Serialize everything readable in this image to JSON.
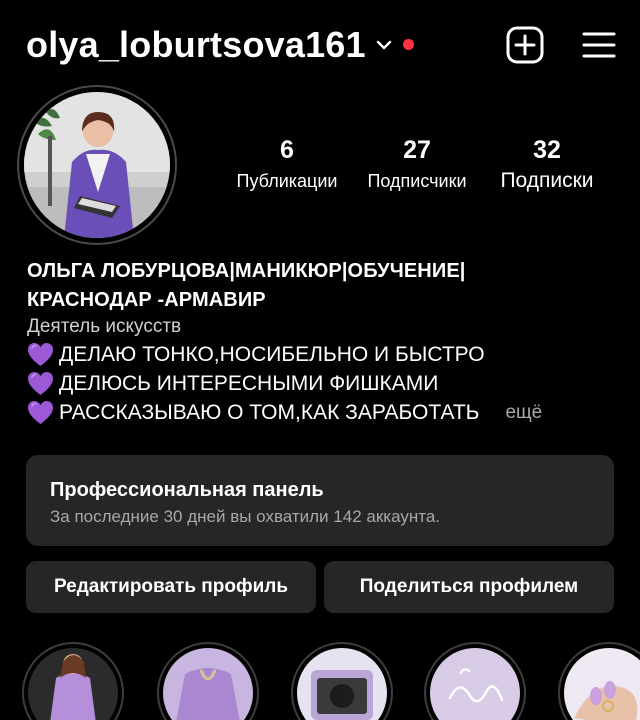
{
  "header": {
    "username": "olya_loburtsova161",
    "notification_color": "#ff3040",
    "icons": [
      "chevron-down-icon",
      "add-post-icon",
      "menu-icon"
    ]
  },
  "stats": [
    {
      "value": "6",
      "label": "Публикации"
    },
    {
      "value": "27",
      "label": "Подписчики"
    },
    {
      "value": "32",
      "label": "Подписки"
    }
  ],
  "profile": {
    "name_line1": "ОЛЬГА ЛОБУРЦОВА|МАНИКЮР|ОБУЧЕНИЕ|",
    "name_line2": "КРАСНОДАР -АРМАВИР",
    "category": "Деятель искусств",
    "bio": [
      "ДЕЛАЮ ТОНКО,НОСИБЕЛЬНО И БЫСТРО",
      "ДЕЛЮСЬ ИНТЕРЕСНЫМИ ФИШКАМИ",
      "РАССКАЗЫВАЮ О ТОМ,КАК ЗАРАБОТАТЬ"
    ],
    "bio_emoji": "purple-heart-icon",
    "more_label": "ещё"
  },
  "pro_panel": {
    "title": "Профессиональная панель",
    "subtitle": "За последние 30 дней вы охватили 142 аккаунта."
  },
  "buttons": {
    "edit_profile": "Редактировать профиль",
    "share_profile": "Поделиться профилем"
  },
  "colors": {
    "background": "#000000",
    "surface": "#262626",
    "secondary_text": "#a8a8a8",
    "accent_purple": "#9b59d6"
  }
}
